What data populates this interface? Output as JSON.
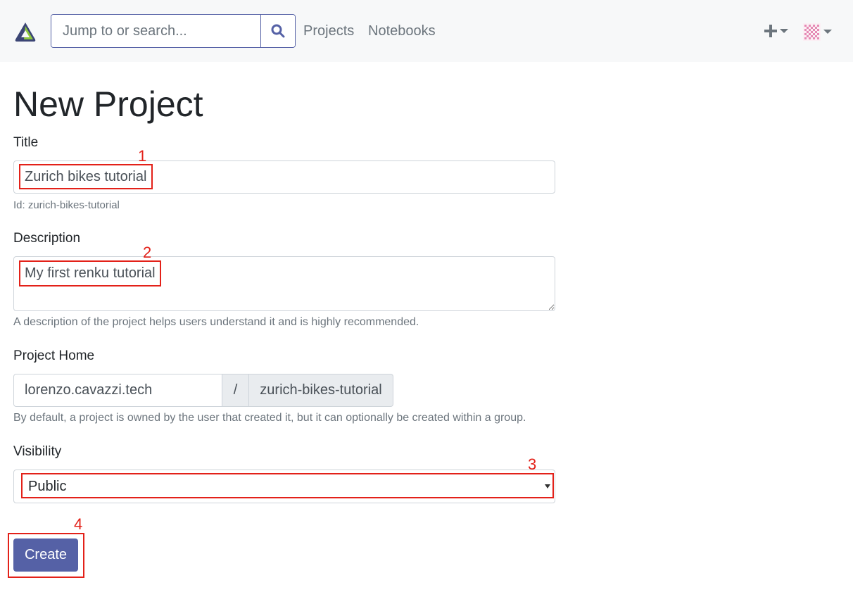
{
  "navbar": {
    "search_placeholder": "Jump to or search...",
    "links": {
      "projects": "Projects",
      "notebooks": "Notebooks"
    },
    "plus_icon": "plus-icon",
    "avatar_icon": "identicon-avatar"
  },
  "page": {
    "title": "New Project"
  },
  "form": {
    "title_label": "Title",
    "title_value": "Zurich bikes tutorial",
    "title_help": "Id: zurich-bikes-tutorial",
    "description_label": "Description",
    "description_value": "My first renku tutorial",
    "description_help": "A description of the project helps users understand it and is highly recommended.",
    "home_label": "Project Home",
    "home_namespace": "lorenzo.cavazzi.tech",
    "home_separator": "/",
    "home_slug": "zurich-bikes-tutorial",
    "home_help": "By default, a project is owned by the user that created it, but it can optionally be created within a group.",
    "visibility_label": "Visibility",
    "visibility_value": "Public",
    "create_label": "Create"
  },
  "annotations": {
    "n1": "1",
    "n2": "2",
    "n3": "3",
    "n4": "4"
  },
  "colors": {
    "accent": "#5561a6",
    "annotation": "#e32119",
    "navbar_bg": "#f7f8f9"
  }
}
